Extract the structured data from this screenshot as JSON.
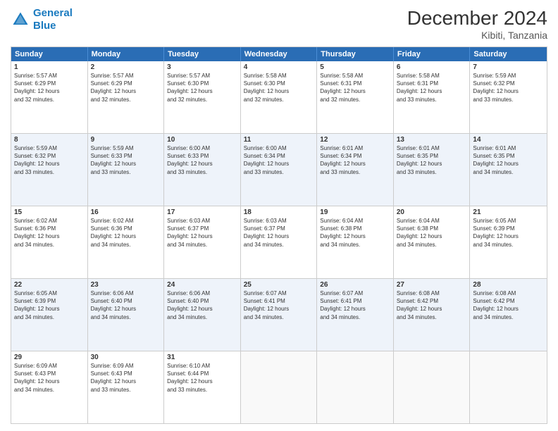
{
  "logo": {
    "line1": "General",
    "line2": "Blue"
  },
  "title": "December 2024",
  "subtitle": "Kibiti, Tanzania",
  "days": [
    "Sunday",
    "Monday",
    "Tuesday",
    "Wednesday",
    "Thursday",
    "Friday",
    "Saturday"
  ],
  "weeks": [
    {
      "alt": false,
      "cells": [
        {
          "day": 1,
          "text": "Sunrise: 5:57 AM\nSunset: 6:29 PM\nDaylight: 12 hours\nand 32 minutes."
        },
        {
          "day": 2,
          "text": "Sunrise: 5:57 AM\nSunset: 6:29 PM\nDaylight: 12 hours\nand 32 minutes."
        },
        {
          "day": 3,
          "text": "Sunrise: 5:57 AM\nSunset: 6:30 PM\nDaylight: 12 hours\nand 32 minutes."
        },
        {
          "day": 4,
          "text": "Sunrise: 5:58 AM\nSunset: 6:30 PM\nDaylight: 12 hours\nand 32 minutes."
        },
        {
          "day": 5,
          "text": "Sunrise: 5:58 AM\nSunset: 6:31 PM\nDaylight: 12 hours\nand 32 minutes."
        },
        {
          "day": 6,
          "text": "Sunrise: 5:58 AM\nSunset: 6:31 PM\nDaylight: 12 hours\nand 33 minutes."
        },
        {
          "day": 7,
          "text": "Sunrise: 5:59 AM\nSunset: 6:32 PM\nDaylight: 12 hours\nand 33 minutes."
        }
      ]
    },
    {
      "alt": true,
      "cells": [
        {
          "day": 8,
          "text": "Sunrise: 5:59 AM\nSunset: 6:32 PM\nDaylight: 12 hours\nand 33 minutes."
        },
        {
          "day": 9,
          "text": "Sunrise: 5:59 AM\nSunset: 6:33 PM\nDaylight: 12 hours\nand 33 minutes."
        },
        {
          "day": 10,
          "text": "Sunrise: 6:00 AM\nSunset: 6:33 PM\nDaylight: 12 hours\nand 33 minutes."
        },
        {
          "day": 11,
          "text": "Sunrise: 6:00 AM\nSunset: 6:34 PM\nDaylight: 12 hours\nand 33 minutes."
        },
        {
          "day": 12,
          "text": "Sunrise: 6:01 AM\nSunset: 6:34 PM\nDaylight: 12 hours\nand 33 minutes."
        },
        {
          "day": 13,
          "text": "Sunrise: 6:01 AM\nSunset: 6:35 PM\nDaylight: 12 hours\nand 33 minutes."
        },
        {
          "day": 14,
          "text": "Sunrise: 6:01 AM\nSunset: 6:35 PM\nDaylight: 12 hours\nand 34 minutes."
        }
      ]
    },
    {
      "alt": false,
      "cells": [
        {
          "day": 15,
          "text": "Sunrise: 6:02 AM\nSunset: 6:36 PM\nDaylight: 12 hours\nand 34 minutes."
        },
        {
          "day": 16,
          "text": "Sunrise: 6:02 AM\nSunset: 6:36 PM\nDaylight: 12 hours\nand 34 minutes."
        },
        {
          "day": 17,
          "text": "Sunrise: 6:03 AM\nSunset: 6:37 PM\nDaylight: 12 hours\nand 34 minutes."
        },
        {
          "day": 18,
          "text": "Sunrise: 6:03 AM\nSunset: 6:37 PM\nDaylight: 12 hours\nand 34 minutes."
        },
        {
          "day": 19,
          "text": "Sunrise: 6:04 AM\nSunset: 6:38 PM\nDaylight: 12 hours\nand 34 minutes."
        },
        {
          "day": 20,
          "text": "Sunrise: 6:04 AM\nSunset: 6:38 PM\nDaylight: 12 hours\nand 34 minutes."
        },
        {
          "day": 21,
          "text": "Sunrise: 6:05 AM\nSunset: 6:39 PM\nDaylight: 12 hours\nand 34 minutes."
        }
      ]
    },
    {
      "alt": true,
      "cells": [
        {
          "day": 22,
          "text": "Sunrise: 6:05 AM\nSunset: 6:39 PM\nDaylight: 12 hours\nand 34 minutes."
        },
        {
          "day": 23,
          "text": "Sunrise: 6:06 AM\nSunset: 6:40 PM\nDaylight: 12 hours\nand 34 minutes."
        },
        {
          "day": 24,
          "text": "Sunrise: 6:06 AM\nSunset: 6:40 PM\nDaylight: 12 hours\nand 34 minutes."
        },
        {
          "day": 25,
          "text": "Sunrise: 6:07 AM\nSunset: 6:41 PM\nDaylight: 12 hours\nand 34 minutes."
        },
        {
          "day": 26,
          "text": "Sunrise: 6:07 AM\nSunset: 6:41 PM\nDaylight: 12 hours\nand 34 minutes."
        },
        {
          "day": 27,
          "text": "Sunrise: 6:08 AM\nSunset: 6:42 PM\nDaylight: 12 hours\nand 34 minutes."
        },
        {
          "day": 28,
          "text": "Sunrise: 6:08 AM\nSunset: 6:42 PM\nDaylight: 12 hours\nand 34 minutes."
        }
      ]
    },
    {
      "alt": false,
      "cells": [
        {
          "day": 29,
          "text": "Sunrise: 6:09 AM\nSunset: 6:43 PM\nDaylight: 12 hours\nand 34 minutes."
        },
        {
          "day": 30,
          "text": "Sunrise: 6:09 AM\nSunset: 6:43 PM\nDaylight: 12 hours\nand 33 minutes."
        },
        {
          "day": 31,
          "text": "Sunrise: 6:10 AM\nSunset: 6:44 PM\nDaylight: 12 hours\nand 33 minutes."
        },
        {
          "day": null,
          "text": ""
        },
        {
          "day": null,
          "text": ""
        },
        {
          "day": null,
          "text": ""
        },
        {
          "day": null,
          "text": ""
        }
      ]
    }
  ]
}
